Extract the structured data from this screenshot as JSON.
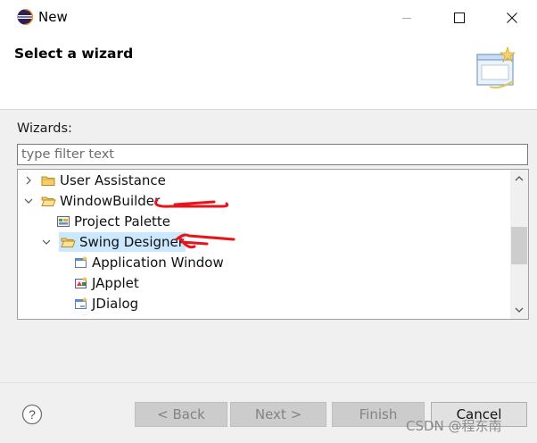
{
  "window": {
    "title": "New",
    "controls": {
      "minimize": "minimize-icon",
      "maximize": "maximize-icon",
      "close": "close-icon"
    }
  },
  "header": {
    "title": "Select a wizard",
    "banner_icon": "wizard-banner-icon"
  },
  "wizards": {
    "label": "Wizards:",
    "filter_placeholder": "type filter text",
    "filter_value": ""
  },
  "tree": {
    "items": [
      {
        "label": "User Assistance",
        "icon": "folder-icon",
        "expanded": false
      },
      {
        "label": "WindowBuilder",
        "icon": "folder-icon",
        "expanded": true
      },
      {
        "label": "Project Palette",
        "icon": "palette-icon"
      },
      {
        "label": "Swing Designer",
        "icon": "folder-icon",
        "expanded": true,
        "selected": true
      },
      {
        "label": "Application Window",
        "icon": "window-icon"
      },
      {
        "label": "JApplet",
        "icon": "applet-icon"
      },
      {
        "label": "JDialog",
        "icon": "dialog-icon"
      }
    ]
  },
  "buttons": {
    "back": "< Back",
    "next": "Next >",
    "finish": "Finish",
    "cancel": "Cancel"
  },
  "watermark": "CSDN @程东南",
  "colors": {
    "selection": "#cce8ff",
    "annotation": "#e8141c",
    "folder": "#e8b84a"
  }
}
